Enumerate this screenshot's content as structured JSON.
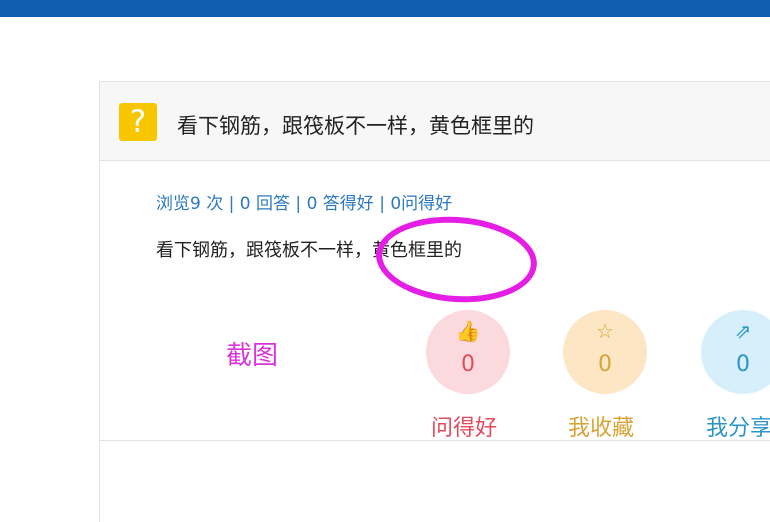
{
  "question": {
    "icon": "question-icon",
    "icon_glyph": "?",
    "title": "看下钢筋，跟筏板不一样，黄色框里的",
    "body": "看下钢筋，跟筏板不一样，黄色框里的"
  },
  "stats": {
    "views": "浏览9 次",
    "answers": "0 回答",
    "good_answers": "0 答得好",
    "good_questions": "0问得好",
    "separator": "|"
  },
  "annotation": {
    "label": "截图",
    "color": "#e51ee5"
  },
  "actions": [
    {
      "icon": "thumbs-up-icon",
      "glyph": "👍",
      "count": "0",
      "label": "问得好",
      "color": "#e24b5d"
    },
    {
      "icon": "star-icon",
      "glyph": "☆",
      "count": "0",
      "label": "我收藏",
      "color": "#d7a437"
    },
    {
      "icon": "share-icon",
      "glyph": "⇗",
      "count": "0",
      "label": "我分享",
      "color": "#2c95c9"
    }
  ],
  "colors": {
    "topbar": "#0f5fae",
    "question_icon_bg": "#f7c600",
    "link": "#2b79c2"
  }
}
